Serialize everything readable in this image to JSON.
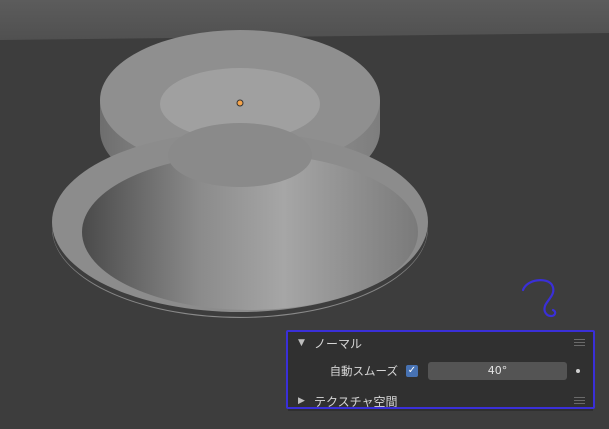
{
  "panel": {
    "normal_section": {
      "title": "ノーマル",
      "expanded": true
    },
    "auto_smooth": {
      "label": "自動スムーズ",
      "checked": true,
      "angle": "40°"
    },
    "texture_space_section": {
      "title": "テクスチャ空間",
      "expanded": false
    }
  },
  "annotation": {
    "color": "#3a2fd8"
  }
}
